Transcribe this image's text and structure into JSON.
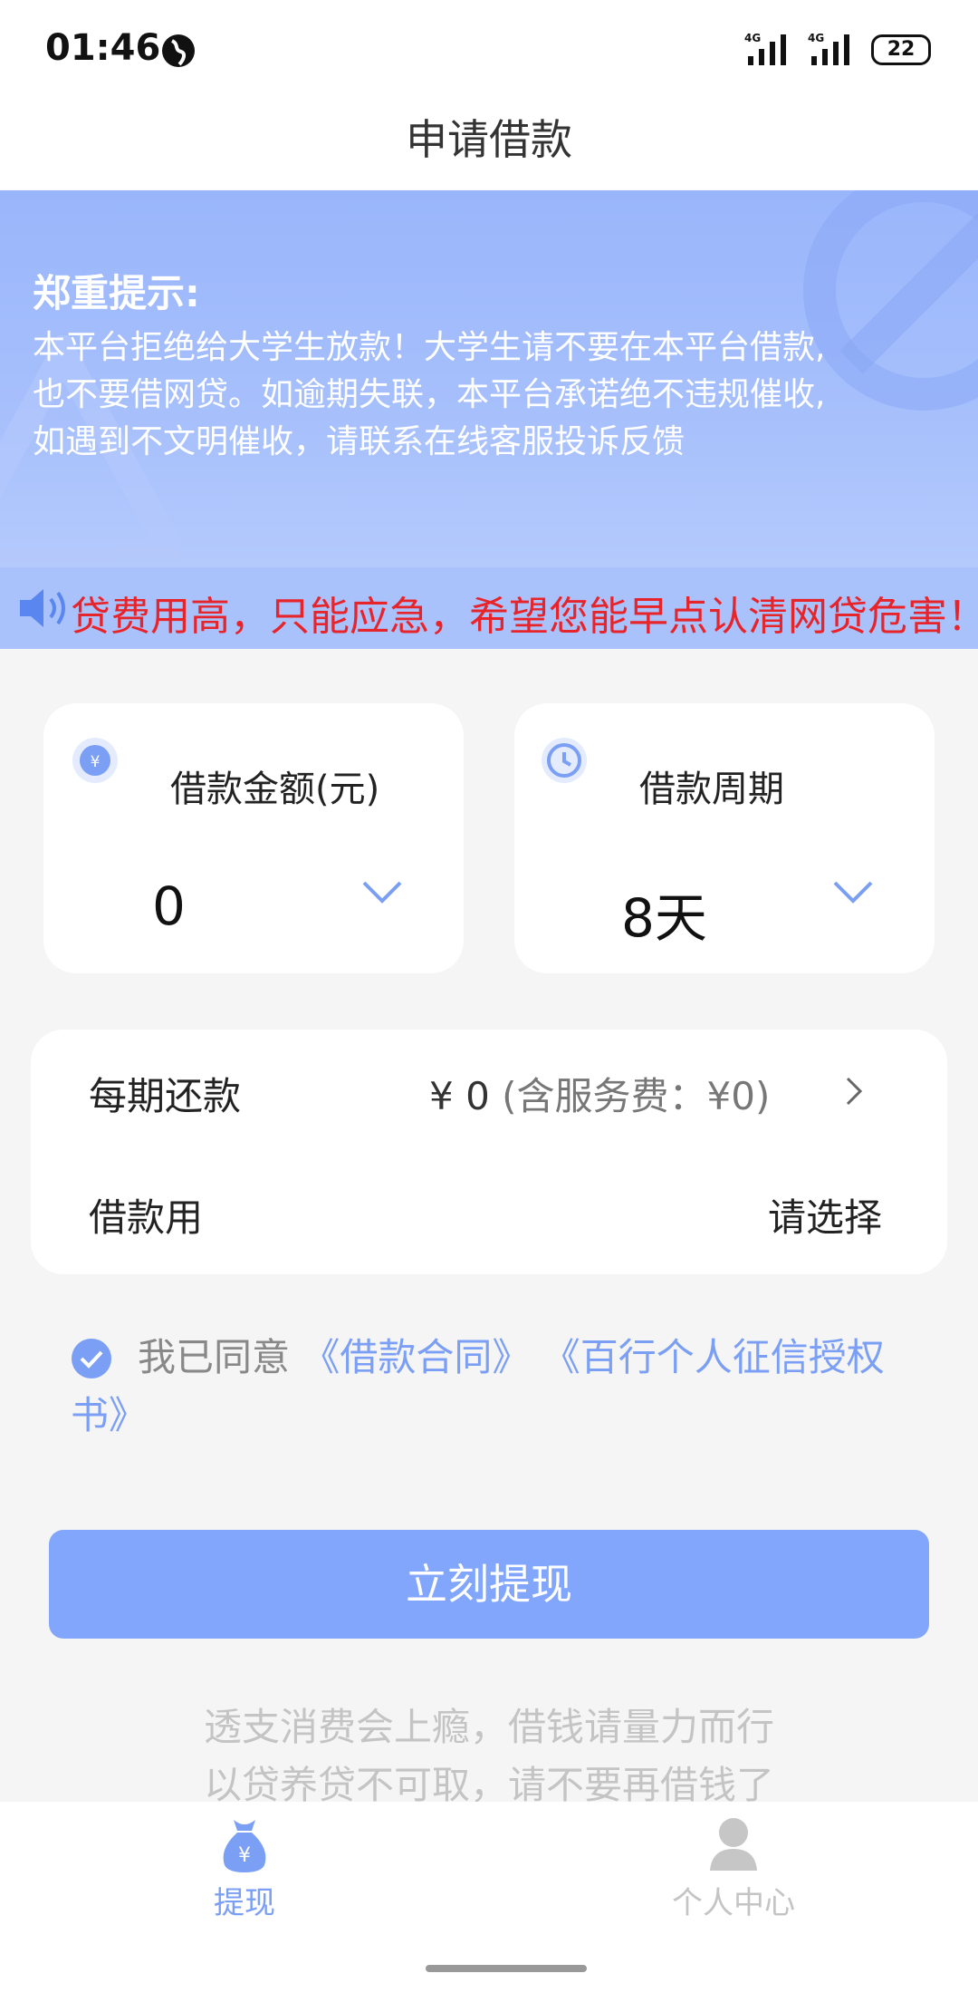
{
  "status": {
    "time": "01:46",
    "network1": "4G",
    "network2": "4G",
    "battery": "22"
  },
  "header": {
    "title": "申请借款"
  },
  "banner": {
    "title": "郑重提示:",
    "lines": [
      "本平台拒绝给大学生放款！大学生请不要在本平台借款,",
      "也不要借网贷。如逾期失联，本平台承诺绝不违规催收,",
      "如遇到不文明催收，请联系在线客服投诉反馈"
    ],
    "marquee": "贷费用高，只能应急，希望您能早点认清网贷危害！"
  },
  "amount_card": {
    "label": "借款金额(元)",
    "value": "0"
  },
  "period_card": {
    "label": "借款周期",
    "value": "8天"
  },
  "info": {
    "repay_label": "每期还款",
    "repay_value": "¥ 0",
    "repay_fee": " (含服务费：¥0)",
    "purpose_label": "借款用",
    "purpose_value": "请选择"
  },
  "agreement": {
    "prefix": "我已同意 ",
    "link1": "《借款合同》",
    "link2": "《百行个人征信授权书》"
  },
  "button": {
    "label": "立刻提现"
  },
  "tips": [
    "透支消费会上瘾，借钱请量力而行",
    "以贷养贷不可取，请不要再借钱了"
  ],
  "tabbar": {
    "tabs": [
      {
        "label": "提现",
        "active": true
      },
      {
        "label": "个人中心",
        "active": false
      }
    ]
  },
  "colors": {
    "accent": "#81a6fb",
    "warn_red": "#e8242b",
    "banner": "#9ab6fb"
  }
}
